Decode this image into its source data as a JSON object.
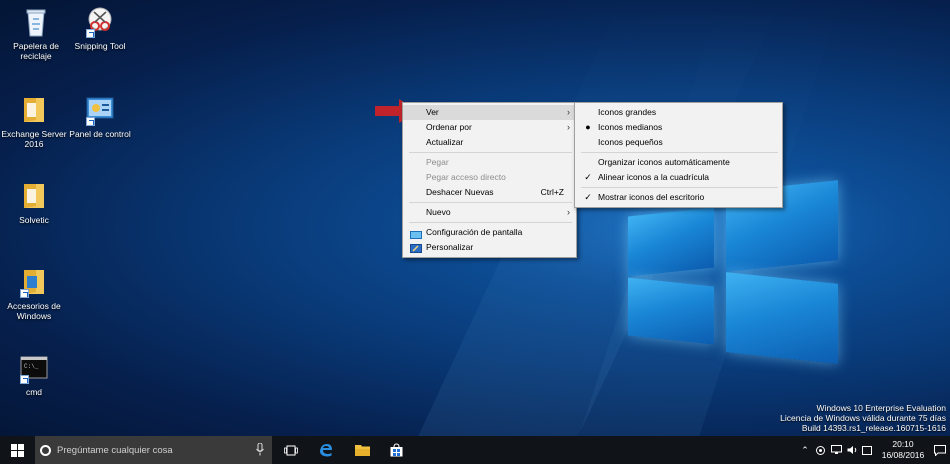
{
  "desktop_icons": [
    {
      "label_line1": "Papelera de",
      "label_line2": "reciclaje"
    },
    {
      "label_line1": "Snipping Tool",
      "label_line2": ""
    },
    {
      "label_line1": "Exchange Server",
      "label_line2": "2016"
    },
    {
      "label_line1": "Panel de control",
      "label_line2": ""
    },
    {
      "label_line1": "Solvetic",
      "label_line2": ""
    },
    {
      "label_line1": "Accesorios de",
      "label_line2": "Windows"
    },
    {
      "label_line1": "cmd",
      "label_line2": ""
    }
  ],
  "context_menu": {
    "items": [
      {
        "label": "Ver"
      },
      {
        "label": "Ordenar por"
      },
      {
        "label": "Actualizar"
      },
      {
        "label": "Pegar"
      },
      {
        "label": "Pegar acceso directo"
      },
      {
        "label": "Deshacer Nuevas",
        "accel": "Ctrl+Z"
      },
      {
        "label": "Nuevo"
      },
      {
        "label": "Configuración de pantalla"
      },
      {
        "label": "Personalizar"
      }
    ]
  },
  "submenu_ver": {
    "items": [
      {
        "label": "Iconos grandes"
      },
      {
        "label": "Iconos medianos"
      },
      {
        "label": "Iconos pequeños"
      },
      {
        "label": "Organizar iconos automáticamente"
      },
      {
        "label": "Alinear iconos a la cuadrícula"
      },
      {
        "label": "Mostrar iconos del escritorio"
      }
    ]
  },
  "taskbar": {
    "search_placeholder": "Pregúntame cualquier cosa",
    "time": "20:10",
    "date": "16/08/2016"
  },
  "watermark": {
    "line1": "Windows 10 Enterprise Evaluation",
    "line2": "Licencia de Windows válida durante 75 días",
    "line3": "Build 14393.rs1_release.160715-1616"
  },
  "colors": {
    "arrow": "#c0242a",
    "taskbar": "#101419",
    "menu_bg": "#f2f2f2",
    "menu_highlight": "#dadada"
  }
}
